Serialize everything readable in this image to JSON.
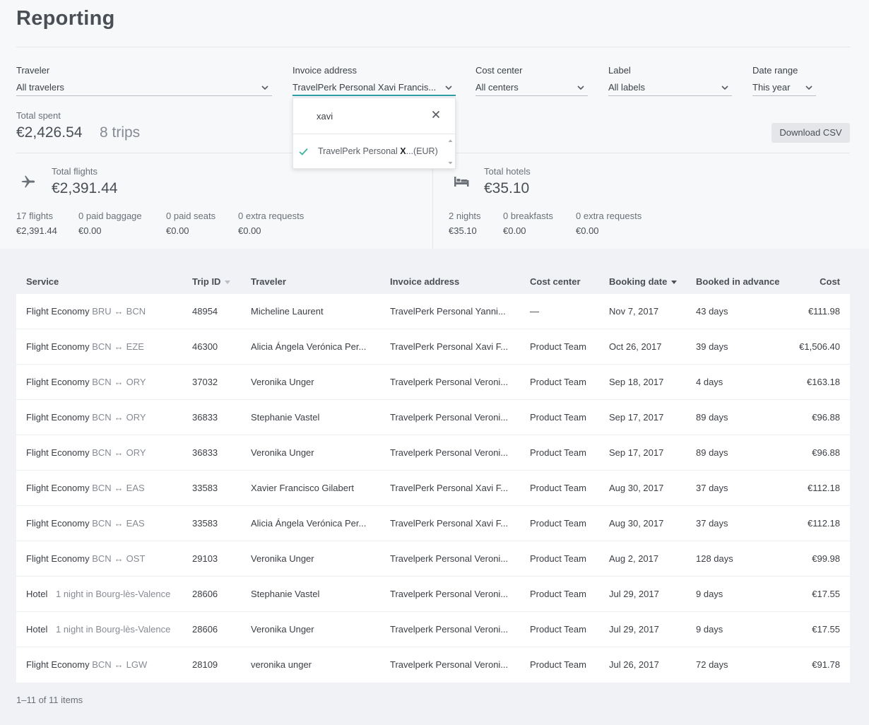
{
  "page": {
    "title": "Reporting"
  },
  "filters": {
    "traveler": {
      "label": "Traveler",
      "value": "All travelers"
    },
    "invoice": {
      "label": "Invoice address",
      "value": "TravelPerk Personal Xavi Francis..."
    },
    "cost_center": {
      "label": "Cost center",
      "value": "All centers"
    },
    "label": {
      "label": "Label",
      "value": "All labels"
    },
    "date_range": {
      "label": "Date range",
      "value": "This year"
    }
  },
  "dropdown": {
    "search_value": "xavi",
    "option": {
      "prefix": "TravelPerk Personal ",
      "match": "X",
      "suffix": "...(EUR)"
    }
  },
  "totals": {
    "label": "Total spent",
    "amount": "€2,426.54",
    "trips": "8 trips"
  },
  "download_csv": "Download CSV",
  "flights": {
    "title": "Total flights",
    "amount": "€2,391.44",
    "metrics": [
      {
        "label": "17 flights",
        "value": "€2,391.44"
      },
      {
        "label": "0 paid baggage",
        "value": "€0.00"
      },
      {
        "label": "0 paid seats",
        "value": "€0.00"
      },
      {
        "label": "0 extra requests",
        "value": "€0.00"
      }
    ]
  },
  "hotels": {
    "title": "Total hotels",
    "amount": "€35.10",
    "metrics": [
      {
        "label": "2 nights",
        "value": "€35.10"
      },
      {
        "label": "0 breakfasts",
        "value": "€0.00"
      },
      {
        "label": "0 extra requests",
        "value": "€0.00"
      }
    ]
  },
  "table": {
    "headers": {
      "service": "Service",
      "trip_id": "Trip ID",
      "traveler": "Traveler",
      "invoice": "Invoice address",
      "cost_center": "Cost center",
      "booking_date": "Booking date",
      "advance": "Booked in advance",
      "cost": "Cost"
    },
    "rows": [
      {
        "service": "Flight Economy",
        "from": "BRU",
        "arrow": "↔",
        "to": "BCN",
        "detail": "",
        "trip_id": "48954",
        "traveler": "Micheline Laurent",
        "invoice": "TravelPerk Personal Yanni...",
        "cost_center": "—",
        "booking_date": "Nov 7, 2017",
        "advance": "43 days",
        "cost": "€111.98"
      },
      {
        "service": "Flight Economy",
        "from": "BCN",
        "arrow": "↔",
        "to": "EZE",
        "detail": "",
        "trip_id": "46300",
        "traveler": "Alicia Ángela Verónica Per...",
        "invoice": "TravelPerk Personal Xavi F...",
        "cost_center": "Product Team",
        "booking_date": "Oct 26, 2017",
        "advance": "39 days",
        "cost": "€1,506.40"
      },
      {
        "service": "Flight Economy",
        "from": "BCN",
        "arrow": "↔",
        "to": "ORY",
        "detail": "",
        "trip_id": "37032",
        "traveler": "Veronika Unger",
        "invoice": "Travelperk Personal Veroni...",
        "cost_center": "Product Team",
        "booking_date": "Sep 18, 2017",
        "advance": "4 days",
        "cost": "€163.18"
      },
      {
        "service": "Flight Economy",
        "from": "BCN",
        "arrow": "↔",
        "to": "ORY",
        "detail": "",
        "trip_id": "36833",
        "traveler": "Stephanie Vastel",
        "invoice": "Travelperk Personal Veroni...",
        "cost_center": "Product Team",
        "booking_date": "Sep 17, 2017",
        "advance": "89 days",
        "cost": "€96.88"
      },
      {
        "service": "Flight Economy",
        "from": "BCN",
        "arrow": "↔",
        "to": "ORY",
        "detail": "",
        "trip_id": "36833",
        "traveler": "Veronika Unger",
        "invoice": "Travelperk Personal Veroni...",
        "cost_center": "Product Team",
        "booking_date": "Sep 17, 2017",
        "advance": "89 days",
        "cost": "€96.88"
      },
      {
        "service": "Flight Economy",
        "from": "BCN",
        "arrow": "↔",
        "to": "EAS",
        "detail": "",
        "trip_id": "33583",
        "traveler": "Xavier Francisco Gilabert",
        "invoice": "TravelPerk Personal Xavi F...",
        "cost_center": "Product Team",
        "booking_date": "Aug 30, 2017",
        "advance": "37 days",
        "cost": "€112.18"
      },
      {
        "service": "Flight Economy",
        "from": "BCN",
        "arrow": "↔",
        "to": "EAS",
        "detail": "",
        "trip_id": "33583",
        "traveler": "Alicia Ángela Verónica Per...",
        "invoice": "TravelPerk Personal Xavi F...",
        "cost_center": "Product Team",
        "booking_date": "Aug 30, 2017",
        "advance": "37 days",
        "cost": "€112.18"
      },
      {
        "service": "Flight Economy",
        "from": "BCN",
        "arrow": "↔",
        "to": "OST",
        "detail": "",
        "trip_id": "29103",
        "traveler": "Veronika Unger",
        "invoice": "Travelperk Personal Veroni...",
        "cost_center": "Product Team",
        "booking_date": "Aug 2, 2017",
        "advance": "128 days",
        "cost": "€99.98"
      },
      {
        "service": "Hotel",
        "from": "",
        "arrow": "",
        "to": "",
        "detail": "1 night in Bourg-lès-Valence",
        "trip_id": "28606",
        "traveler": "Stephanie Vastel",
        "invoice": "Travelperk Personal Veroni...",
        "cost_center": "Product Team",
        "booking_date": "Jul 29, 2017",
        "advance": "9 days",
        "cost": "€17.55"
      },
      {
        "service": "Hotel",
        "from": "",
        "arrow": "",
        "to": "",
        "detail": "1 night in Bourg-lès-Valence",
        "trip_id": "28606",
        "traveler": "Veronika Unger",
        "invoice": "Travelperk Personal Veroni...",
        "cost_center": "Product Team",
        "booking_date": "Jul 29, 2017",
        "advance": "9 days",
        "cost": "€17.55"
      },
      {
        "service": "Flight Economy",
        "from": "BCN",
        "arrow": "↔",
        "to": "LGW",
        "detail": "",
        "trip_id": "28109",
        "traveler": "veronika unger",
        "invoice": "Travelperk Personal Veroni...",
        "cost_center": "Product Team",
        "booking_date": "Jul 26, 2017",
        "advance": "72 days",
        "cost": "€91.78"
      }
    ]
  },
  "pagination": "1–11 of 11 items",
  "colors": {
    "accent": "#2f9ea6",
    "check": "#3fb39a"
  },
  "icons": [
    "chevron-down-icon",
    "close-icon",
    "checkmark-icon",
    "airplane-icon",
    "bed-icon",
    "sort-icon"
  ]
}
